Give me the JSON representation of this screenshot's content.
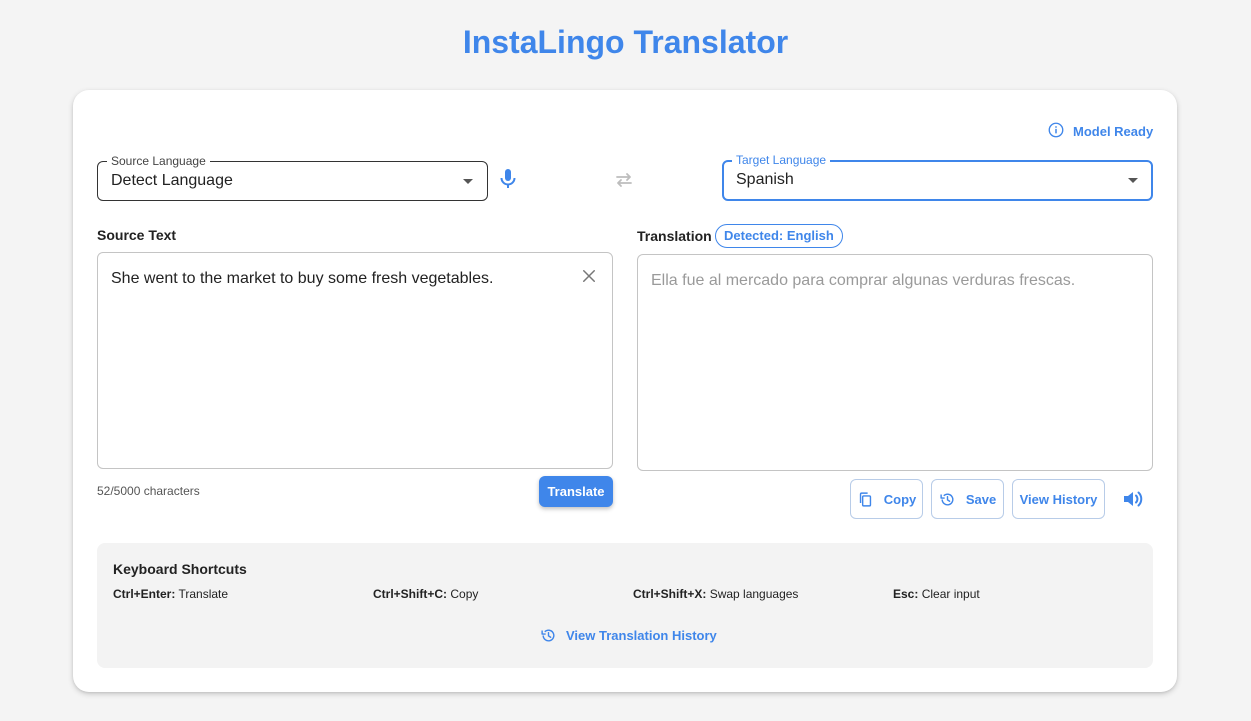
{
  "app": {
    "title": "InstaLingo Translator"
  },
  "status": {
    "model": "Model Ready"
  },
  "source_language": {
    "label": "Source Language",
    "value": "Detect Language"
  },
  "target_language": {
    "label": "Target Language",
    "value": "Spanish"
  },
  "source": {
    "label": "Source Text",
    "text": "She went to the market to buy some fresh vegetables.",
    "char_count": "52/5000 characters",
    "translate_label": "Translate"
  },
  "translation": {
    "label": "Translation",
    "detected": "Detected: English",
    "text": "Ella fue al mercado para comprar algunas verduras frescas.",
    "copy_label": "Copy",
    "save_label": "Save",
    "history_label": "View History"
  },
  "shortcuts": {
    "title": "Keyboard Shortcuts",
    "items": [
      {
        "keys": "Ctrl+Enter:",
        "action": "Translate"
      },
      {
        "keys": "Ctrl+Shift+C:",
        "action": "Copy"
      },
      {
        "keys": "Ctrl+Shift+X:",
        "action": "Swap languages"
      },
      {
        "keys": "Esc:",
        "action": "Clear input"
      }
    ],
    "history_link": "View Translation History"
  },
  "colors": {
    "accent": "#3f86ea",
    "background": "#f4f4f4",
    "panel": "#f3f3f3"
  },
  "icons": [
    "info-icon",
    "mic-icon",
    "swap-icon",
    "close-icon",
    "copy-icon",
    "history-icon",
    "speaker-icon"
  ]
}
